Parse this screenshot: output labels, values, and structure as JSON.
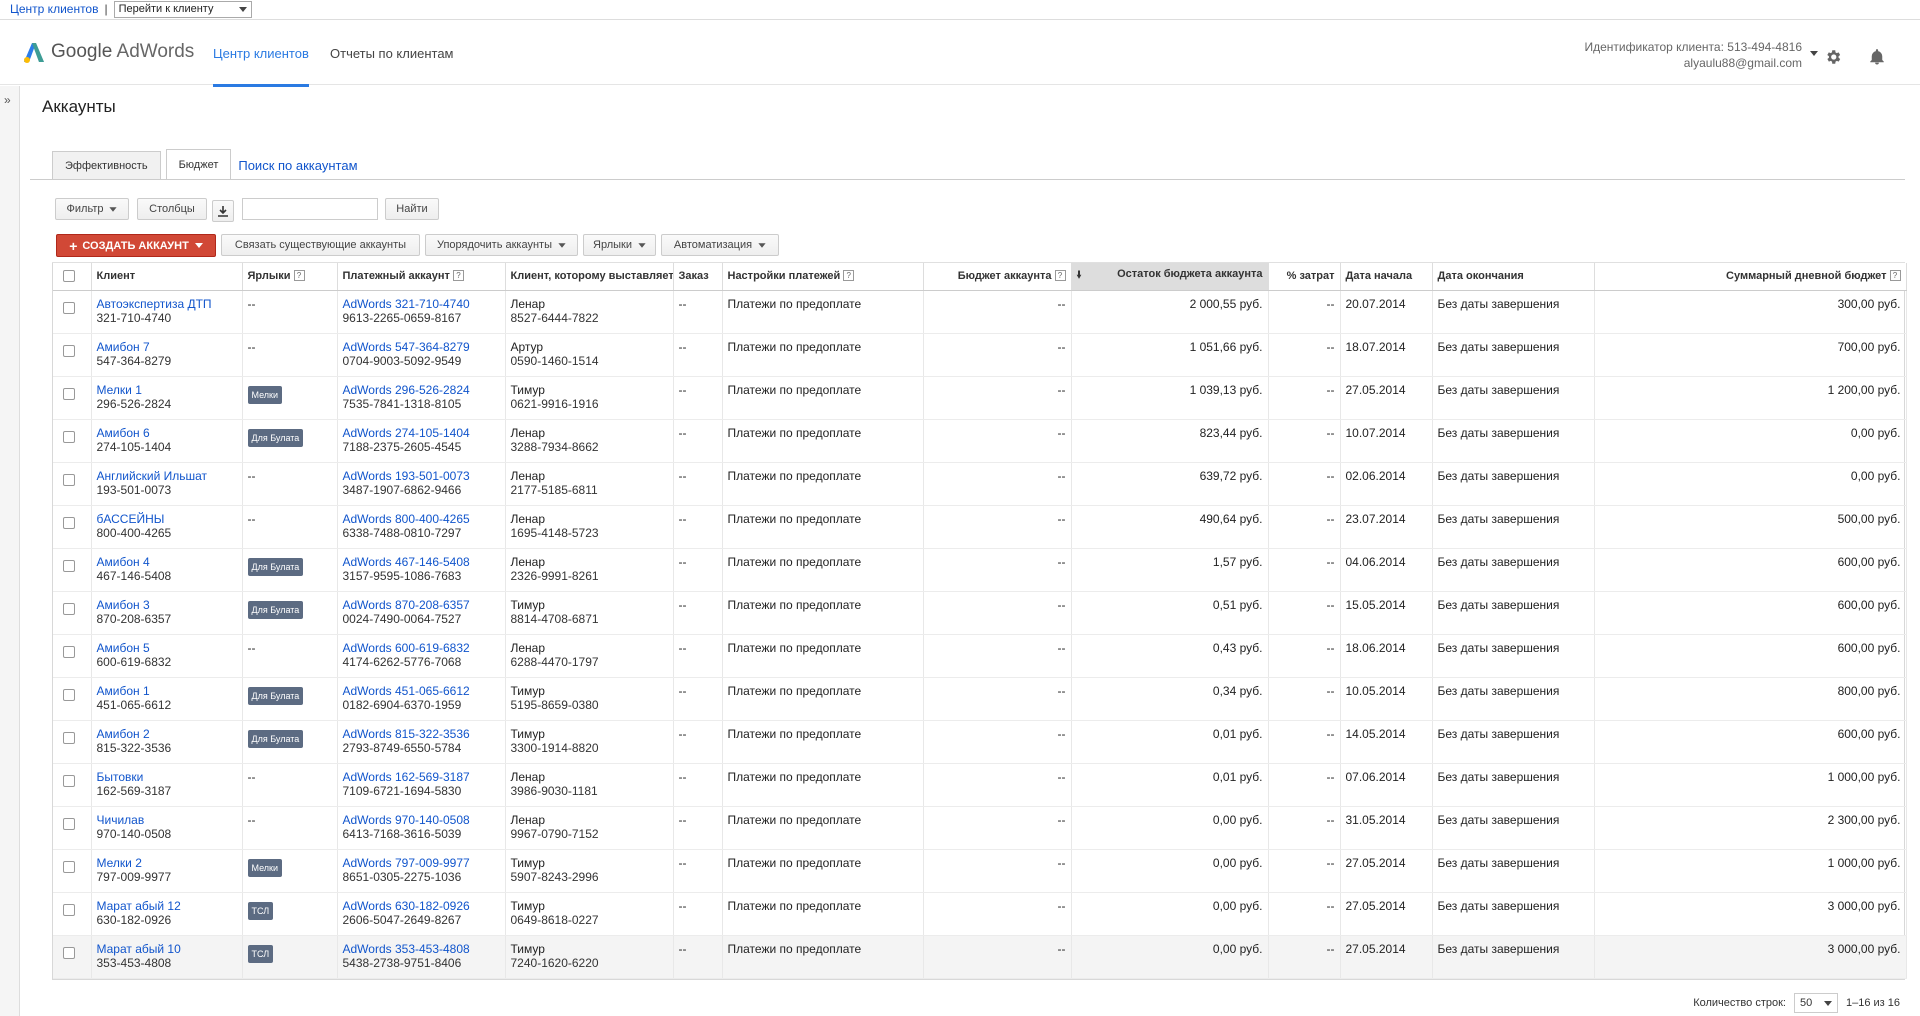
{
  "topbar": {
    "mcc_link": "Центр клиентов",
    "separator": "|",
    "jump_select": "Перейти к клиенту"
  },
  "header": {
    "logo_google": "Google",
    "logo_adwords": "AdWords",
    "tabs": [
      {
        "label": "Центр клиентов",
        "active": true
      },
      {
        "label": "Отчеты по клиентам",
        "active": false
      }
    ],
    "client_id": "Идентификатор клиента: 513-494-4816",
    "email": "alyaulu88@gmail.com"
  },
  "icons": {
    "settings": "gear-icon",
    "notifications": "bell-icon",
    "expand": "double-chevron-right-icon"
  },
  "rail": {
    "glyph": "»"
  },
  "page_title": "Аккаунты",
  "tabs": [
    "Эффективность",
    "Бюджет",
    "Поиск по аккаунтам"
  ],
  "toolbar": {
    "filter": "Фильтр",
    "columns": "Столбцы",
    "search_value": "",
    "find": "Найти",
    "create": "СОЗДАТЬ АККАУНТ",
    "link_accounts": "Связать существующие аккаунты",
    "organize": "Упорядочить аккаунты",
    "labels": "Ярлыки",
    "automation": "Автоматизация"
  },
  "columns": [
    "Клиент",
    "Ярлыки",
    "Платежный аккаунт",
    "Клиент, которому выставляется счет",
    "Заказ",
    "Настройки платежей",
    "Бюджет аккаунта",
    "Остаток бюджета аккаунта",
    "% затрат",
    "Дата начала",
    "Дата окончания",
    "Суммарный дневной бюджет"
  ],
  "rows": [
    {
      "name": "Автоэкспертиза ДТП",
      "id": "321-710-4740",
      "label": "--",
      "pay": "AdWords 321-710-4740",
      "pay_id": "9613-2265-0659-8167",
      "bill": "Ленар",
      "bill_id": "8527-6444-7822",
      "order": "--",
      "settings": "Платежи по предоплате",
      "budget": "--",
      "remain": "2 000,55 руб.",
      "pct": "--",
      "start": "20.07.2014",
      "end": "Без даты завершения",
      "daily": "300,00 руб."
    },
    {
      "name": "Амибон 7",
      "id": "547-364-8279",
      "label": "--",
      "pay": "AdWords 547-364-8279",
      "pay_id": "0704-9003-5092-9549",
      "bill": "Артур",
      "bill_id": "0590-1460-1514",
      "order": "--",
      "settings": "Платежи по предоплате",
      "budget": "--",
      "remain": "1 051,66 руб.",
      "pct": "--",
      "start": "18.07.2014",
      "end": "Без даты завершения",
      "daily": "700,00 руб."
    },
    {
      "name": "Мелки 1",
      "id": "296-526-2824",
      "label": "Мелки",
      "pay": "AdWords 296-526-2824",
      "pay_id": "7535-7841-1318-8105",
      "bill": "Тимур",
      "bill_id": "0621-9916-1916",
      "order": "--",
      "settings": "Платежи по предоплате",
      "budget": "--",
      "remain": "1 039,13 руб.",
      "pct": "--",
      "start": "27.05.2014",
      "end": "Без даты завершения",
      "daily": "1 200,00 руб."
    },
    {
      "name": "Амибон 6",
      "id": "274-105-1404",
      "label": "Для Булата",
      "pay": "AdWords 274-105-1404",
      "pay_id": "7188-2375-2605-4545",
      "bill": "Ленар",
      "bill_id": "3288-7934-8662",
      "order": "--",
      "settings": "Платежи по предоплате",
      "budget": "--",
      "remain": "823,44 руб.",
      "pct": "--",
      "start": "10.07.2014",
      "end": "Без даты завершения",
      "daily": "0,00 руб."
    },
    {
      "name": "Английский Ильшат",
      "id": "193-501-0073",
      "label": "--",
      "pay": "AdWords 193-501-0073",
      "pay_id": "3487-1907-6862-9466",
      "bill": "Ленар",
      "bill_id": "2177-5185-6811",
      "order": "--",
      "settings": "Платежи по предоплате",
      "budget": "--",
      "remain": "639,72 руб.",
      "pct": "--",
      "start": "02.06.2014",
      "end": "Без даты завершения",
      "daily": "0,00 руб."
    },
    {
      "name": "бАССЕЙНЫ",
      "id": "800-400-4265",
      "label": "--",
      "pay": "AdWords 800-400-4265",
      "pay_id": "6338-7488-0810-7297",
      "bill": "Ленар",
      "bill_id": "1695-4148-5723",
      "order": "--",
      "settings": "Платежи по предоплате",
      "budget": "--",
      "remain": "490,64 руб.",
      "pct": "--",
      "start": "23.07.2014",
      "end": "Без даты завершения",
      "daily": "500,00 руб."
    },
    {
      "name": "Амибон 4",
      "id": "467-146-5408",
      "label": "Для Булата",
      "pay": "AdWords 467-146-5408",
      "pay_id": "3157-9595-1086-7683",
      "bill": "Ленар",
      "bill_id": "2326-9991-8261",
      "order": "--",
      "settings": "Платежи по предоплате",
      "budget": "--",
      "remain": "1,57 руб.",
      "pct": "--",
      "start": "04.06.2014",
      "end": "Без даты завершения",
      "daily": "600,00 руб."
    },
    {
      "name": "Амибон 3",
      "id": "870-208-6357",
      "label": "Для Булата",
      "pay": "AdWords 870-208-6357",
      "pay_id": "0024-7490-0064-7527",
      "bill": "Тимур",
      "bill_id": "8814-4708-6871",
      "order": "--",
      "settings": "Платежи по предоплате",
      "budget": "--",
      "remain": "0,51 руб.",
      "pct": "--",
      "start": "15.05.2014",
      "end": "Без даты завершения",
      "daily": "600,00 руб."
    },
    {
      "name": "Амибон 5",
      "id": "600-619-6832",
      "label": "--",
      "pay": "AdWords 600-619-6832",
      "pay_id": "4174-6262-5776-7068",
      "bill": "Ленар",
      "bill_id": "6288-4470-1797",
      "order": "--",
      "settings": "Платежи по предоплате",
      "budget": "--",
      "remain": "0,43 руб.",
      "pct": "--",
      "start": "18.06.2014",
      "end": "Без даты завершения",
      "daily": "600,00 руб."
    },
    {
      "name": "Амибон 1",
      "id": "451-065-6612",
      "label": "Для Булата",
      "pay": "AdWords 451-065-6612",
      "pay_id": "0182-6904-6370-1959",
      "bill": "Тимур",
      "bill_id": "5195-8659-0380",
      "order": "--",
      "settings": "Платежи по предоплате",
      "budget": "--",
      "remain": "0,34 руб.",
      "pct": "--",
      "start": "10.05.2014",
      "end": "Без даты завершения",
      "daily": "800,00 руб."
    },
    {
      "name": "Амибон 2",
      "id": "815-322-3536",
      "label": "Для Булата",
      "pay": "AdWords 815-322-3536",
      "pay_id": "2793-8749-6550-5784",
      "bill": "Тимур",
      "bill_id": "3300-1914-8820",
      "order": "--",
      "settings": "Платежи по предоплате",
      "budget": "--",
      "remain": "0,01 руб.",
      "pct": "--",
      "start": "14.05.2014",
      "end": "Без даты завершения",
      "daily": "600,00 руб."
    },
    {
      "name": "Бытовки",
      "id": "162-569-3187",
      "label": "--",
      "pay": "AdWords 162-569-3187",
      "pay_id": "7109-6721-1694-5830",
      "bill": "Ленар",
      "bill_id": "3986-9030-1181",
      "order": "--",
      "settings": "Платежи по предоплате",
      "budget": "--",
      "remain": "0,01 руб.",
      "pct": "--",
      "start": "07.06.2014",
      "end": "Без даты завершения",
      "daily": "1 000,00 руб."
    },
    {
      "name": "Чичилав",
      "id": "970-140-0508",
      "label": "--",
      "pay": "AdWords 970-140-0508",
      "pay_id": "6413-7168-3616-5039",
      "bill": "Ленар",
      "bill_id": "9967-0790-7152",
      "order": "--",
      "settings": "Платежи по предоплате",
      "budget": "--",
      "remain": "0,00 руб.",
      "pct": "--",
      "start": "31.05.2014",
      "end": "Без даты завершения",
      "daily": "2 300,00 руб."
    },
    {
      "name": "Мелки 2",
      "id": "797-009-9977",
      "label": "Мелки",
      "pay": "AdWords 797-009-9977",
      "pay_id": "8651-0305-2275-1036",
      "bill": "Тимур",
      "bill_id": "5907-8243-2996",
      "order": "--",
      "settings": "Платежи по предоплате",
      "budget": "--",
      "remain": "0,00 руб.",
      "pct": "--",
      "start": "27.05.2014",
      "end": "Без даты завершения",
      "daily": "1 000,00 руб."
    },
    {
      "name": "Марат абый 12",
      "id": "630-182-0926",
      "label": "ТСЛ",
      "pay": "AdWords 630-182-0926",
      "pay_id": "2606-5047-2649-8267",
      "bill": "Тимур",
      "bill_id": "0649-8618-0227",
      "order": "--",
      "settings": "Платежи по предоплате",
      "budget": "--",
      "remain": "0,00 руб.",
      "pct": "--",
      "start": "27.05.2014",
      "end": "Без даты завершения",
      "daily": "3 000,00 руб."
    },
    {
      "name": "Марат абый 10",
      "id": "353-453-4808",
      "label": "ТСЛ",
      "pay": "AdWords 353-453-4808",
      "pay_id": "5438-2738-9751-8406",
      "bill": "Тимур",
      "bill_id": "7240-1620-6220",
      "order": "--",
      "settings": "Платежи по предоплате",
      "budget": "--",
      "remain": "0,00 руб.",
      "pct": "--",
      "start": "27.05.2014",
      "end": "Без даты завершения",
      "daily": "3 000,00 руб."
    }
  ],
  "footer": {
    "rows_label": "Количество строк:",
    "rows_value": "50",
    "range": "1–16 из 16"
  }
}
